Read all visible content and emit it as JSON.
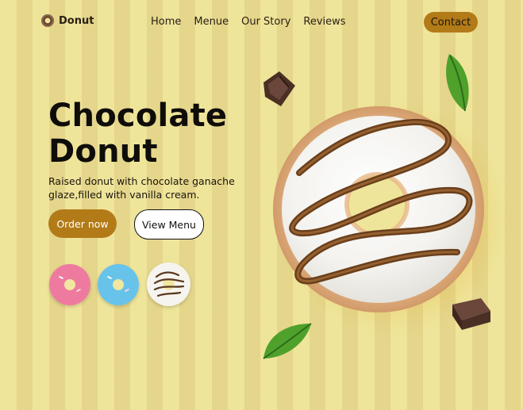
{
  "brand": {
    "name": "Donut"
  },
  "nav": {
    "items": [
      "Home",
      "Menue",
      "Our Story",
      "Reviews"
    ]
  },
  "header": {
    "contact_label": "Contact"
  },
  "hero": {
    "title": "Chocolate\nDonut",
    "subtitle": "Raised donut with chocolate ganache glaze,filled with vanilla cream.",
    "primary_cta": "Order now",
    "secondary_cta": "View Menu"
  },
  "thumbnails": [
    {
      "name": "pink-donut-thumbnail"
    },
    {
      "name": "blue-donut-thumbnail"
    },
    {
      "name": "white-chocolate-donut-thumbnail"
    }
  ],
  "colors": {
    "background": "#f1e7a0",
    "accent": "#b27b18",
    "text": "#0f0d0a"
  },
  "icons": {
    "logo": "donut-logo-icon",
    "chocolate": "chocolate-piece-icon",
    "leaf": "leaf-icon"
  }
}
